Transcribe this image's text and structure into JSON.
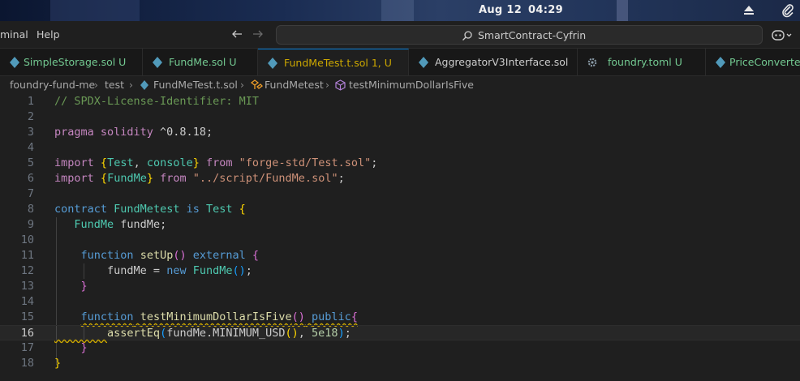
{
  "os_bar": {
    "date": "Aug 12",
    "time": "04:29",
    "icons": [
      "eject-icon",
      "paperclip-icon"
    ]
  },
  "menu": {
    "items": [
      "minal",
      "Help"
    ]
  },
  "command_center": {
    "text": "SmartContract-Cyfrin",
    "icon": "search-icon"
  },
  "tabs": [
    {
      "label": "SimpleStorage.sol U",
      "status": "modified",
      "icon": "solidity-icon"
    },
    {
      "label": "FundMe.sol U",
      "status": "modified",
      "icon": "solidity-icon"
    },
    {
      "label": "FundMeTest.t.sol 1, U",
      "status": "warning",
      "icon": "solidity-icon",
      "active": true
    },
    {
      "label": "AggregatorV3Interface.sol",
      "status": "plain",
      "icon": "solidity-icon"
    },
    {
      "label": "foundry.toml U",
      "status": "modified",
      "icon": "gear-icon"
    },
    {
      "label": "PriceConverter",
      "status": "modified",
      "icon": "solidity-icon"
    }
  ],
  "breadcrumb": {
    "items": [
      "foundry-fund-me",
      "test",
      "FundMeTest.t.sol",
      "FundMetest",
      "testMinimumDollarIsFive"
    ]
  },
  "editor": {
    "current_line": 16,
    "lines": [
      {
        "n": "1"
      },
      {
        "n": "2"
      },
      {
        "n": "3"
      },
      {
        "n": "4"
      },
      {
        "n": "5"
      },
      {
        "n": "6"
      },
      {
        "n": "7"
      },
      {
        "n": "8"
      },
      {
        "n": "9"
      },
      {
        "n": "10"
      },
      {
        "n": "11"
      },
      {
        "n": "12"
      },
      {
        "n": "13"
      },
      {
        "n": "14"
      },
      {
        "n": "15"
      },
      {
        "n": "16"
      },
      {
        "n": "17"
      },
      {
        "n": "18"
      }
    ],
    "code": {
      "l1": "// SPDX-License-Identifier: MIT",
      "l3_a": "pragma solidity",
      "l3_b": " ^0.8.18;",
      "l5_a": "import",
      "l5_b": "{",
      "l5_c": "Test",
      "l5_d": ", ",
      "l5_e": "console",
      "l5_f": "}",
      "l5_g": " from ",
      "l5_h": "\"forge-std/Test.sol\"",
      "l5_i": ";",
      "l6_a": "import",
      "l6_b": "{",
      "l6_c": "FundMe",
      "l6_d": "}",
      "l6_e": " from ",
      "l6_f": "\"../script/FundMe.sol\"",
      "l6_g": ";",
      "l8_a": "contract",
      "l8_b": "FundMetest",
      "l8_c": "is",
      "l8_d": "Test",
      "l8_e": "{",
      "l9_a": "FundMe",
      "l9_b": " fundMe;",
      "l11_a": "function",
      "l11_b": "setUp",
      "l11_c": "()",
      "l11_d": "external",
      "l11_e": "{",
      "l12_a": "fundMe = ",
      "l12_b": "new",
      "l12_c": "FundMe",
      "l12_d": "()",
      "l12_e": ";",
      "l13": "}",
      "l15_a": "function",
      "l15_b": "testMinimumDollarIsFive",
      "l15_c": "()",
      "l15_d": "public",
      "l15_e": "{",
      "l16_a": "assertEq",
      "l16_b": "(",
      "l16_c": "fundMe.MINIMUM_USD",
      "l16_d": "()",
      "l16_e": ", ",
      "l16_f": "5e18",
      "l16_g": ")",
      "l16_h": ";",
      "l17": "}",
      "l18": "}"
    }
  },
  "colors": {
    "modified": "#73c991",
    "warning": "#cca700",
    "accent": "#0078d4"
  }
}
